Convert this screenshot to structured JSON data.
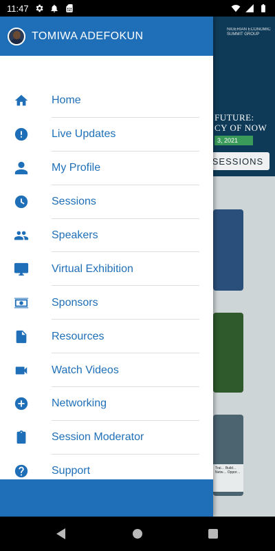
{
  "status_bar": {
    "time": "11:47",
    "left_icons": [
      "gear-icon",
      "bell-icon",
      "sim-card-icon"
    ],
    "right_icons": [
      "wifi-icon",
      "signal-icon",
      "battery-icon"
    ]
  },
  "drawer": {
    "user_name": "TOMIWA ADEFOKUN",
    "items": [
      {
        "label": "Home",
        "icon": "home-icon"
      },
      {
        "label": "Live Updates",
        "icon": "alert-circle-icon"
      },
      {
        "label": "My Profile",
        "icon": "person-icon"
      },
      {
        "label": "Sessions",
        "icon": "clock-icon"
      },
      {
        "label": "Speakers",
        "icon": "people-icon"
      },
      {
        "label": "Virtual Exhibition",
        "icon": "monitor-icon"
      },
      {
        "label": "Sponsors",
        "icon": "money-icon"
      },
      {
        "label": "Resources",
        "icon": "document-icon"
      },
      {
        "label": "Watch Videos",
        "icon": "video-camera-icon"
      },
      {
        "label": "Networking",
        "icon": "plus-circle-icon"
      },
      {
        "label": "Session Moderator",
        "icon": "clipboard-icon"
      },
      {
        "label": "Support",
        "icon": "help-icon"
      }
    ]
  },
  "background": {
    "banner_line1": "FUTURE:",
    "banner_line2": "CY OF NOW",
    "banner_date": "3, 2021",
    "sessions_button": "SESSIONS",
    "banner_logo_text": "NIGERIAN ECONOMIC SUMMIT GROUP",
    "card_caption": "Trai… Build… Netw… Oppor…"
  },
  "colors": {
    "primary": "#1f6fb8",
    "banner": "#0f3a57",
    "date_badge": "#3a9a5a"
  }
}
